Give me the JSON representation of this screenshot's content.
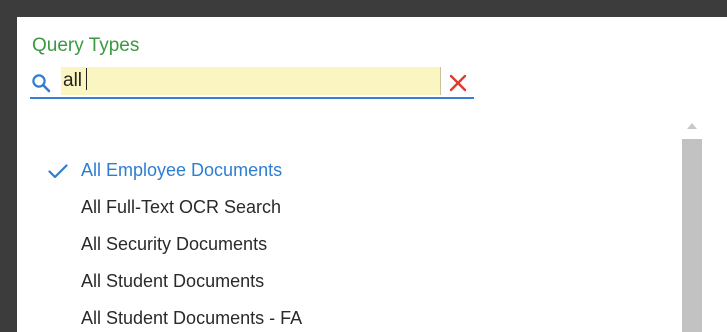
{
  "panel": {
    "title": "Query Types"
  },
  "search": {
    "value": "all",
    "icon": "search-icon",
    "clear_icon": "close-icon"
  },
  "query_types": [
    {
      "label": "All Employee Documents",
      "selected": true
    },
    {
      "label": "All Full-Text OCR Search",
      "selected": false
    },
    {
      "label": "All Security Documents",
      "selected": false
    },
    {
      "label": "All Student Documents",
      "selected": false
    },
    {
      "label": "All Student Documents - FA",
      "selected": false
    }
  ],
  "colors": {
    "title": "#3a9a42",
    "selected_text": "#2f7dd0",
    "search_highlight": "#fbf5c2",
    "clear_icon": "#e03a2f",
    "search_underline": "#3a7fd0"
  }
}
